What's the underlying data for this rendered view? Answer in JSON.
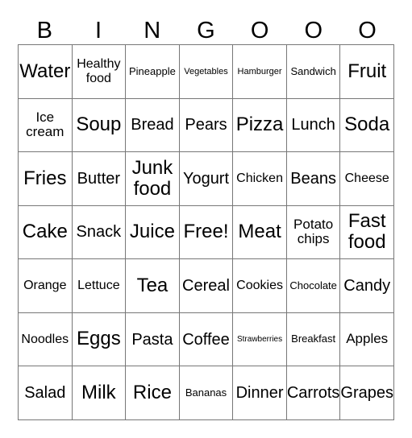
{
  "header": [
    "B",
    "I",
    "N",
    "G",
    "O",
    "O",
    "O"
  ],
  "cells": [
    [
      "Water",
      "Healthy food",
      "Pineapple",
      "Vegetables",
      "Hamburger",
      "Sandwich",
      "Fruit"
    ],
    [
      "Ice cream",
      "Soup",
      "Bread",
      "Pears",
      "Pizza",
      "Lunch",
      "Soda"
    ],
    [
      "Fries",
      "Butter",
      "Junk food",
      "Yogurt",
      "Chicken",
      "Beans",
      "Cheese"
    ],
    [
      "Cake",
      "Snack",
      "Juice",
      "Free!",
      "Meat",
      "Potato chips",
      "Fast food"
    ],
    [
      "Orange",
      "Lettuce",
      "Tea",
      "Cereal",
      "Cookies",
      "Chocolate",
      "Candy"
    ],
    [
      "Noodles",
      "Eggs",
      "Pasta",
      "Coffee",
      "Strawberries",
      "Breakfast",
      "Apples"
    ],
    [
      "Salad",
      "Milk",
      "Rice",
      "Bananas",
      "Dinner",
      "Carrots",
      "Grapes"
    ]
  ]
}
